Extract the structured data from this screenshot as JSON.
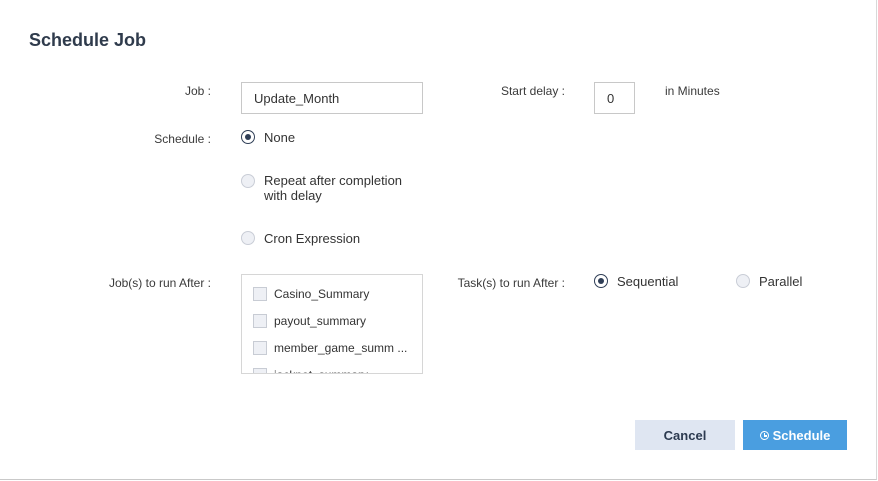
{
  "dialog": {
    "title": "Schedule Job",
    "job": {
      "label": "Job :",
      "value": "Update_Month"
    },
    "start_delay": {
      "label": "Start delay :",
      "value": "0",
      "unit": "in Minutes"
    },
    "schedule": {
      "label": "Schedule :",
      "options": [
        {
          "label": "None",
          "checked": true
        },
        {
          "label_line1": "Repeat after completion",
          "label_line2": "with delay",
          "checked": false
        },
        {
          "label": "Cron Expression",
          "checked": false
        }
      ]
    },
    "jobs_after": {
      "label": "Job(s) to run After :",
      "items": [
        "Casino_Summary",
        "payout_summary",
        "member_game_summ ...",
        "jackpot_summary"
      ]
    },
    "tasks_after": {
      "label": "Task(s) to run After :",
      "options": [
        {
          "label": "Sequential",
          "checked": true
        },
        {
          "label": "Parallel",
          "checked": false
        }
      ]
    },
    "buttons": {
      "cancel": "Cancel",
      "schedule": "Schedule"
    }
  }
}
